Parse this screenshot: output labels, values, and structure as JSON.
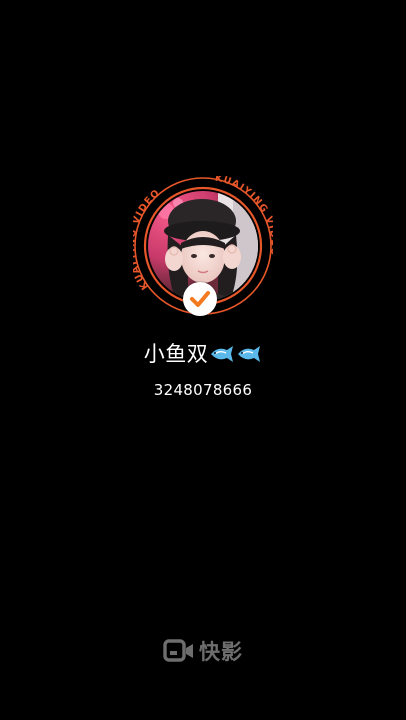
{
  "profile": {
    "badge_text": "KUAIYING VIDEO",
    "nickname": "小鱼双",
    "nickname_icons": [
      "fish-icon",
      "fish-icon"
    ],
    "user_id": "3248078666",
    "verified_icon": "check-icon"
  },
  "footer": {
    "brand_text": "快影",
    "brand_icon": "video-camera-icon"
  },
  "colors": {
    "background": "#000000",
    "badge_ring": "#e8572a",
    "verified_check": "#f47a20",
    "brand_gray": "#6e6e6e"
  }
}
